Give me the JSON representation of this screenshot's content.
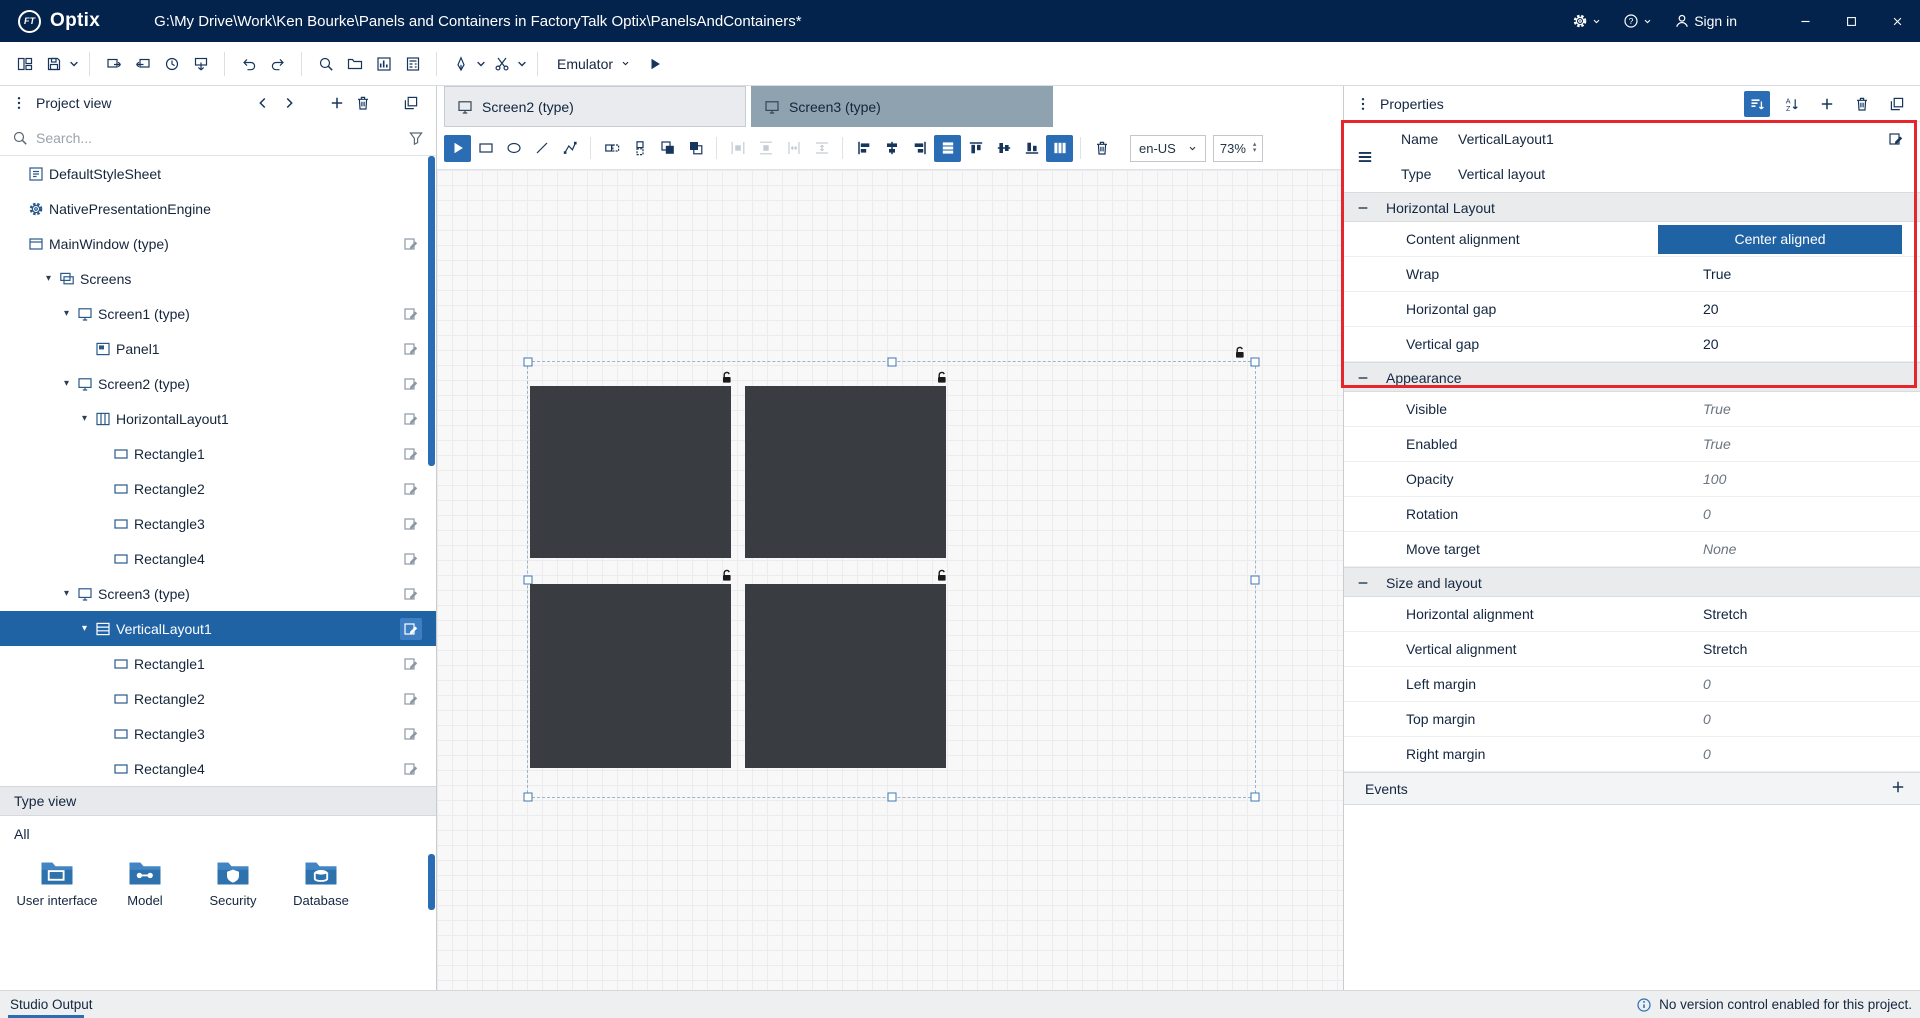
{
  "titlebar": {
    "app_name": "Optix",
    "logo_monogram": "FT",
    "path": "G:\\My Drive\\Work\\Ken Bourke\\Panels and Containers in FactoryTalk Optix\\PanelsAndContainers*",
    "sign_in_label": "Sign in"
  },
  "main_toolbar": {
    "emulator_label": "Emulator"
  },
  "project_panel": {
    "title": "Project view",
    "search_placeholder": "Search...",
    "tree": [
      {
        "label": "DefaultStyleSheet",
        "depth": 0,
        "arrow": false,
        "icon": "stylesheet",
        "edit": false,
        "selected": false
      },
      {
        "label": "NativePresentationEngine",
        "depth": 0,
        "arrow": false,
        "icon": "engine",
        "edit": false,
        "selected": false
      },
      {
        "label": "MainWindow (type)",
        "depth": 0,
        "arrow": false,
        "icon": "window",
        "edit": true,
        "selected": false
      },
      {
        "label": "Screens",
        "depth": 1,
        "arrow": true,
        "icon": "screens",
        "edit": false,
        "selected": false
      },
      {
        "label": "Screen1 (type)",
        "depth": 2,
        "arrow": true,
        "icon": "screen",
        "edit": true,
        "selected": false
      },
      {
        "label": "Panel1",
        "depth": 3,
        "arrow": false,
        "icon": "panel",
        "edit": true,
        "selected": false
      },
      {
        "label": "Screen2 (type)",
        "depth": 2,
        "arrow": true,
        "icon": "screen",
        "edit": true,
        "selected": false
      },
      {
        "label": "HorizontalLayout1",
        "depth": 3,
        "arrow": true,
        "icon": "hlayout",
        "edit": true,
        "selected": false
      },
      {
        "label": "Rectangle1",
        "depth": 4,
        "arrow": false,
        "icon": "rectangle",
        "edit": true,
        "selected": false
      },
      {
        "label": "Rectangle2",
        "depth": 4,
        "arrow": false,
        "icon": "rectangle",
        "edit": true,
        "selected": false
      },
      {
        "label": "Rectangle3",
        "depth": 4,
        "arrow": false,
        "icon": "rectangle",
        "edit": true,
        "selected": false
      },
      {
        "label": "Rectangle4",
        "depth": 4,
        "arrow": false,
        "icon": "rectangle",
        "edit": true,
        "selected": false
      },
      {
        "label": "Screen3 (type)",
        "depth": 2,
        "arrow": true,
        "icon": "screen",
        "edit": true,
        "selected": false
      },
      {
        "label": "VerticalLayout1",
        "depth": 3,
        "arrow": true,
        "icon": "vlayout",
        "edit": true,
        "selected": true
      },
      {
        "label": "Rectangle1",
        "depth": 4,
        "arrow": false,
        "icon": "rectangle",
        "edit": true,
        "selected": false
      },
      {
        "label": "Rectangle2",
        "depth": 4,
        "arrow": false,
        "icon": "rectangle",
        "edit": true,
        "selected": false
      },
      {
        "label": "Rectangle3",
        "depth": 4,
        "arrow": false,
        "icon": "rectangle",
        "edit": true,
        "selected": false
      },
      {
        "label": "Rectangle4",
        "depth": 4,
        "arrow": false,
        "icon": "rectangle",
        "edit": true,
        "selected": false
      }
    ],
    "type_view": {
      "title": "Type view",
      "filter_all": "All",
      "categories": [
        {
          "label": "User interface",
          "icon": "cat-ui"
        },
        {
          "label": "Model",
          "icon": "cat-model"
        },
        {
          "label": "Security",
          "icon": "cat-security"
        },
        {
          "label": "Database",
          "icon": "cat-database"
        }
      ]
    }
  },
  "editor": {
    "tabs": [
      {
        "label": "Screen2 (type)",
        "active": false
      },
      {
        "label": "Screen3 (type)",
        "active": true
      }
    ],
    "locale": "en-US",
    "zoom": "73%",
    "canvas": {
      "selected_element": "VerticalLayout1",
      "rectangle_count": 4
    }
  },
  "properties_panel": {
    "title": "Properties",
    "name_label": "Name",
    "name_value": "VerticalLayout1",
    "type_label": "Type",
    "type_value": "Vertical layout",
    "sections": [
      {
        "title": "Horizontal Layout",
        "rows": [
          {
            "label": "Content alignment",
            "value": "Center aligned",
            "style": "button"
          },
          {
            "label": "Wrap",
            "value": "True",
            "style": "normal"
          },
          {
            "label": "Horizontal gap",
            "value": "20",
            "style": "normal"
          },
          {
            "label": "Vertical gap",
            "value": "20",
            "style": "normal"
          }
        ]
      },
      {
        "title": "Appearance",
        "rows": [
          {
            "label": "Visible",
            "value": "True",
            "style": "italic"
          },
          {
            "label": "Enabled",
            "value": "True",
            "style": "italic"
          },
          {
            "label": "Opacity",
            "value": "100",
            "style": "italic"
          },
          {
            "label": "Rotation",
            "value": "0",
            "style": "italic"
          },
          {
            "label": "Move target",
            "value": "None",
            "style": "italic"
          }
        ]
      },
      {
        "title": "Size and layout",
        "rows": [
          {
            "label": "Horizontal alignment",
            "value": "Stretch",
            "style": "normal"
          },
          {
            "label": "Vertical alignment",
            "value": "Stretch",
            "style": "normal"
          },
          {
            "label": "Left margin",
            "value": "0",
            "style": "italic"
          },
          {
            "label": "Top margin",
            "value": "0",
            "style": "italic"
          },
          {
            "label": "Right margin",
            "value": "0",
            "style": "italic"
          }
        ]
      }
    ],
    "events_label": "Events"
  },
  "status_bar": {
    "studio_output_label": "Studio Output",
    "message": "No version control enabled for this project."
  },
  "colors": {
    "titlebar_navy": "#04234c",
    "accent_blue": "#2a6db4",
    "selection_blue": "#1f63a5",
    "annotation_red": "#e6252c",
    "rectangle_fill": "#393d41"
  },
  "icons": {
    "search": "magnifier",
    "settings": "gear",
    "help": "question-mark",
    "account": "person",
    "delete": "trash-can",
    "lock": "open-padlock"
  }
}
